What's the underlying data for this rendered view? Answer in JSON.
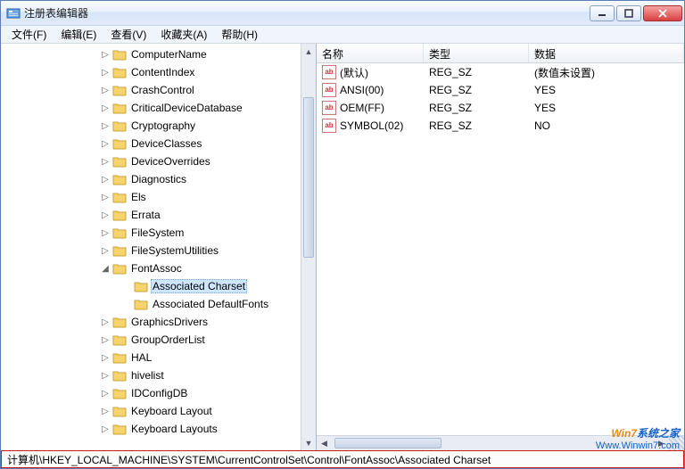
{
  "window": {
    "title": "注册表编辑器"
  },
  "menu": {
    "file": "文件(F)",
    "edit": "编辑(E)",
    "view": "查看(V)",
    "favorites": "收藏夹(A)",
    "help": "帮助(H)"
  },
  "tree": {
    "items": [
      {
        "indent": 110,
        "toggle": "▷",
        "label": "ComputerName"
      },
      {
        "indent": 110,
        "toggle": "▷",
        "label": "ContentIndex"
      },
      {
        "indent": 110,
        "toggle": "▷",
        "label": "CrashControl"
      },
      {
        "indent": 110,
        "toggle": "▷",
        "label": "CriticalDeviceDatabase"
      },
      {
        "indent": 110,
        "toggle": "▷",
        "label": "Cryptography"
      },
      {
        "indent": 110,
        "toggle": "▷",
        "label": "DeviceClasses"
      },
      {
        "indent": 110,
        "toggle": "▷",
        "label": "DeviceOverrides"
      },
      {
        "indent": 110,
        "toggle": "▷",
        "label": "Diagnostics"
      },
      {
        "indent": 110,
        "toggle": "▷",
        "label": "Els"
      },
      {
        "indent": 110,
        "toggle": "▷",
        "label": "Errata"
      },
      {
        "indent": 110,
        "toggle": "▷",
        "label": "FileSystem"
      },
      {
        "indent": 110,
        "toggle": "▷",
        "label": "FileSystemUtilities"
      },
      {
        "indent": 110,
        "toggle": "◢",
        "label": "FontAssoc"
      },
      {
        "indent": 134,
        "toggle": "",
        "label": "Associated Charset",
        "selected": true
      },
      {
        "indent": 134,
        "toggle": "",
        "label": "Associated DefaultFonts"
      },
      {
        "indent": 110,
        "toggle": "▷",
        "label": "GraphicsDrivers"
      },
      {
        "indent": 110,
        "toggle": "▷",
        "label": "GroupOrderList"
      },
      {
        "indent": 110,
        "toggle": "▷",
        "label": "HAL"
      },
      {
        "indent": 110,
        "toggle": "▷",
        "label": "hivelist"
      },
      {
        "indent": 110,
        "toggle": "▷",
        "label": "IDConfigDB"
      },
      {
        "indent": 110,
        "toggle": "▷",
        "label": "Keyboard Layout"
      },
      {
        "indent": 110,
        "toggle": "▷",
        "label": "Keyboard Layouts"
      }
    ]
  },
  "list": {
    "columns": {
      "name": "名称",
      "type": "类型",
      "data": "数据"
    },
    "colwidths": {
      "name": 120,
      "type": 118,
      "data": 150
    },
    "rows": [
      {
        "name": "(默认)",
        "type": "REG_SZ",
        "data": "(数值未设置)"
      },
      {
        "name": "ANSI(00)",
        "type": "REG_SZ",
        "data": "YES"
      },
      {
        "name": "OEM(FF)",
        "type": "REG_SZ",
        "data": "YES"
      },
      {
        "name": "SYMBOL(02)",
        "type": "REG_SZ",
        "data": "NO"
      }
    ]
  },
  "statusbar": {
    "path": "计算机\\HKEY_LOCAL_MACHINE\\SYSTEM\\CurrentControlSet\\Control\\FontAssoc\\Associated Charset"
  },
  "watermark": {
    "line1a": "Win7",
    "line1b": "系统之家",
    "line2": "Www.Winwin7.com"
  }
}
